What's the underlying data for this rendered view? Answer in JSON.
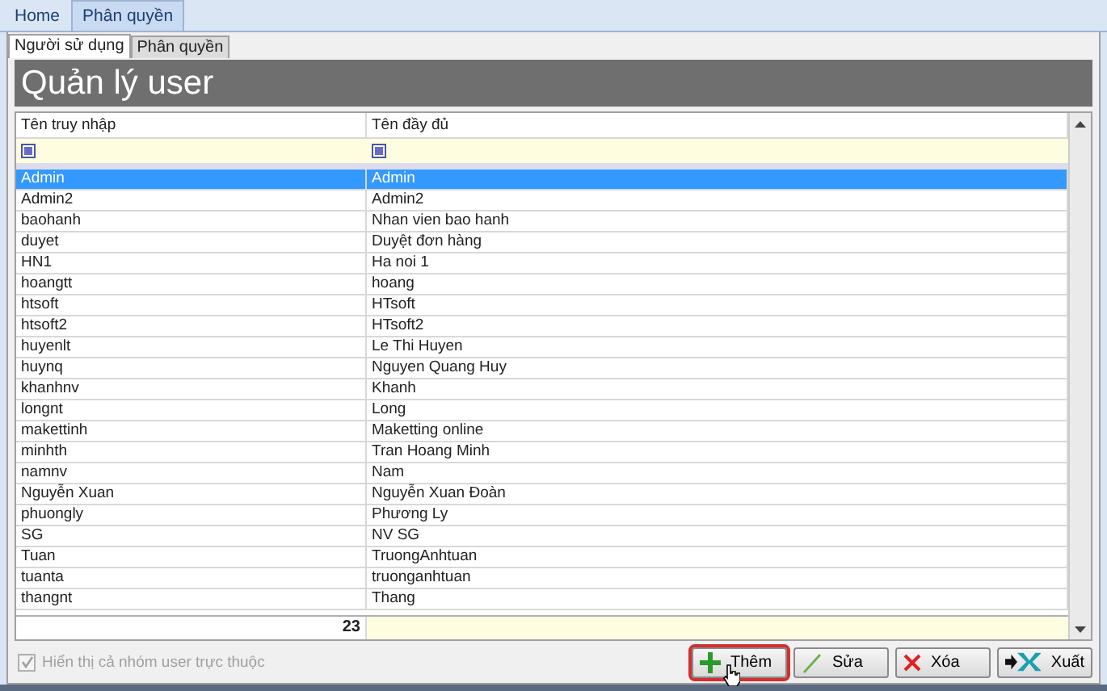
{
  "top_tabs": [
    {
      "label": "Home",
      "selected": false
    },
    {
      "label": "Phân quyền",
      "selected": true
    }
  ],
  "sub_tabs": [
    {
      "label": "Người sử dụng",
      "selected": true
    },
    {
      "label": "Phân quyền",
      "selected": false
    }
  ],
  "title": "Quản lý user",
  "table": {
    "columns": [
      "Tên truy nhập",
      "Tên đầy đủ"
    ],
    "rows": [
      {
        "cells": [
          "Admin",
          "Admin"
        ],
        "selected": true
      },
      {
        "cells": [
          "Admin2",
          "Admin2"
        ],
        "selected": false
      },
      {
        "cells": [
          "baohanh",
          "Nhan vien bao hanh"
        ],
        "selected": false
      },
      {
        "cells": [
          "duyet",
          "Duyệt đơn hàng"
        ],
        "selected": false
      },
      {
        "cells": [
          "HN1",
          "Ha noi 1"
        ],
        "selected": false
      },
      {
        "cells": [
          "hoangtt",
          "hoang"
        ],
        "selected": false
      },
      {
        "cells": [
          "htsoft",
          "HTsoft"
        ],
        "selected": false
      },
      {
        "cells": [
          "htsoft2",
          "HTsoft2"
        ],
        "selected": false
      },
      {
        "cells": [
          "huyenlt",
          "Le Thi Huyen"
        ],
        "selected": false
      },
      {
        "cells": [
          "huynq",
          "Nguyen Quang Huy"
        ],
        "selected": false
      },
      {
        "cells": [
          "khanhnv",
          "Khanh"
        ],
        "selected": false
      },
      {
        "cells": [
          "longnt",
          "Long"
        ],
        "selected": false
      },
      {
        "cells": [
          "makettinh",
          "Maketting online"
        ],
        "selected": false
      },
      {
        "cells": [
          "minhth",
          "Tran Hoang Minh"
        ],
        "selected": false
      },
      {
        "cells": [
          "namnv",
          "Nam"
        ],
        "selected": false
      },
      {
        "cells": [
          "Nguyễn Xuan",
          "Nguyễn Xuan Đoàn"
        ],
        "selected": false
      },
      {
        "cells": [
          "phuongly",
          "Phương Ly"
        ],
        "selected": false
      },
      {
        "cells": [
          "SG",
          "NV SG"
        ],
        "selected": false
      },
      {
        "cells": [
          "Tuan",
          "TruongAnhtuan"
        ],
        "selected": false
      },
      {
        "cells": [
          "tuanta",
          "truonganhtuan"
        ],
        "selected": false
      },
      {
        "cells": [
          "thangnt",
          "Thang"
        ],
        "selected": false
      }
    ],
    "count": "23"
  },
  "show_groups": {
    "label": "Hiển thị cả nhóm user trực thuộc",
    "checked": true,
    "disabled": true
  },
  "buttons": [
    {
      "label": "Thêm",
      "kind": "add",
      "focused": true
    },
    {
      "label": "Sửa",
      "kind": "edit",
      "focused": false
    },
    {
      "label": "Xóa",
      "kind": "delete",
      "focused": false
    },
    {
      "label": "Xuất",
      "kind": "export",
      "focused": false
    }
  ]
}
